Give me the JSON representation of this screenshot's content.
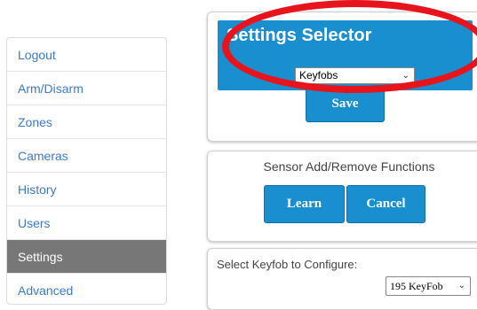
{
  "sidebar": {
    "items": [
      {
        "label": "Logout"
      },
      {
        "label": "Arm/Disarm"
      },
      {
        "label": "Zones"
      },
      {
        "label": "Cameras"
      },
      {
        "label": "History"
      },
      {
        "label": "Users"
      },
      {
        "label": "Settings"
      },
      {
        "label": "Advanced"
      }
    ],
    "active": "Settings"
  },
  "settings_selector": {
    "title": "Settings Selector",
    "selected": "Keyfobs",
    "save_label": "Save"
  },
  "sensor": {
    "heading": "Sensor Add/Remove Functions",
    "learn_label": "Learn",
    "cancel_label": "Cancel"
  },
  "keyfob": {
    "label": "Select Keyfob to Configure:",
    "selected": "195 KeyFob"
  },
  "colors": {
    "accent": "#1a8fd0",
    "active_sidebar": "#777777",
    "annotation": "#e8141c"
  }
}
